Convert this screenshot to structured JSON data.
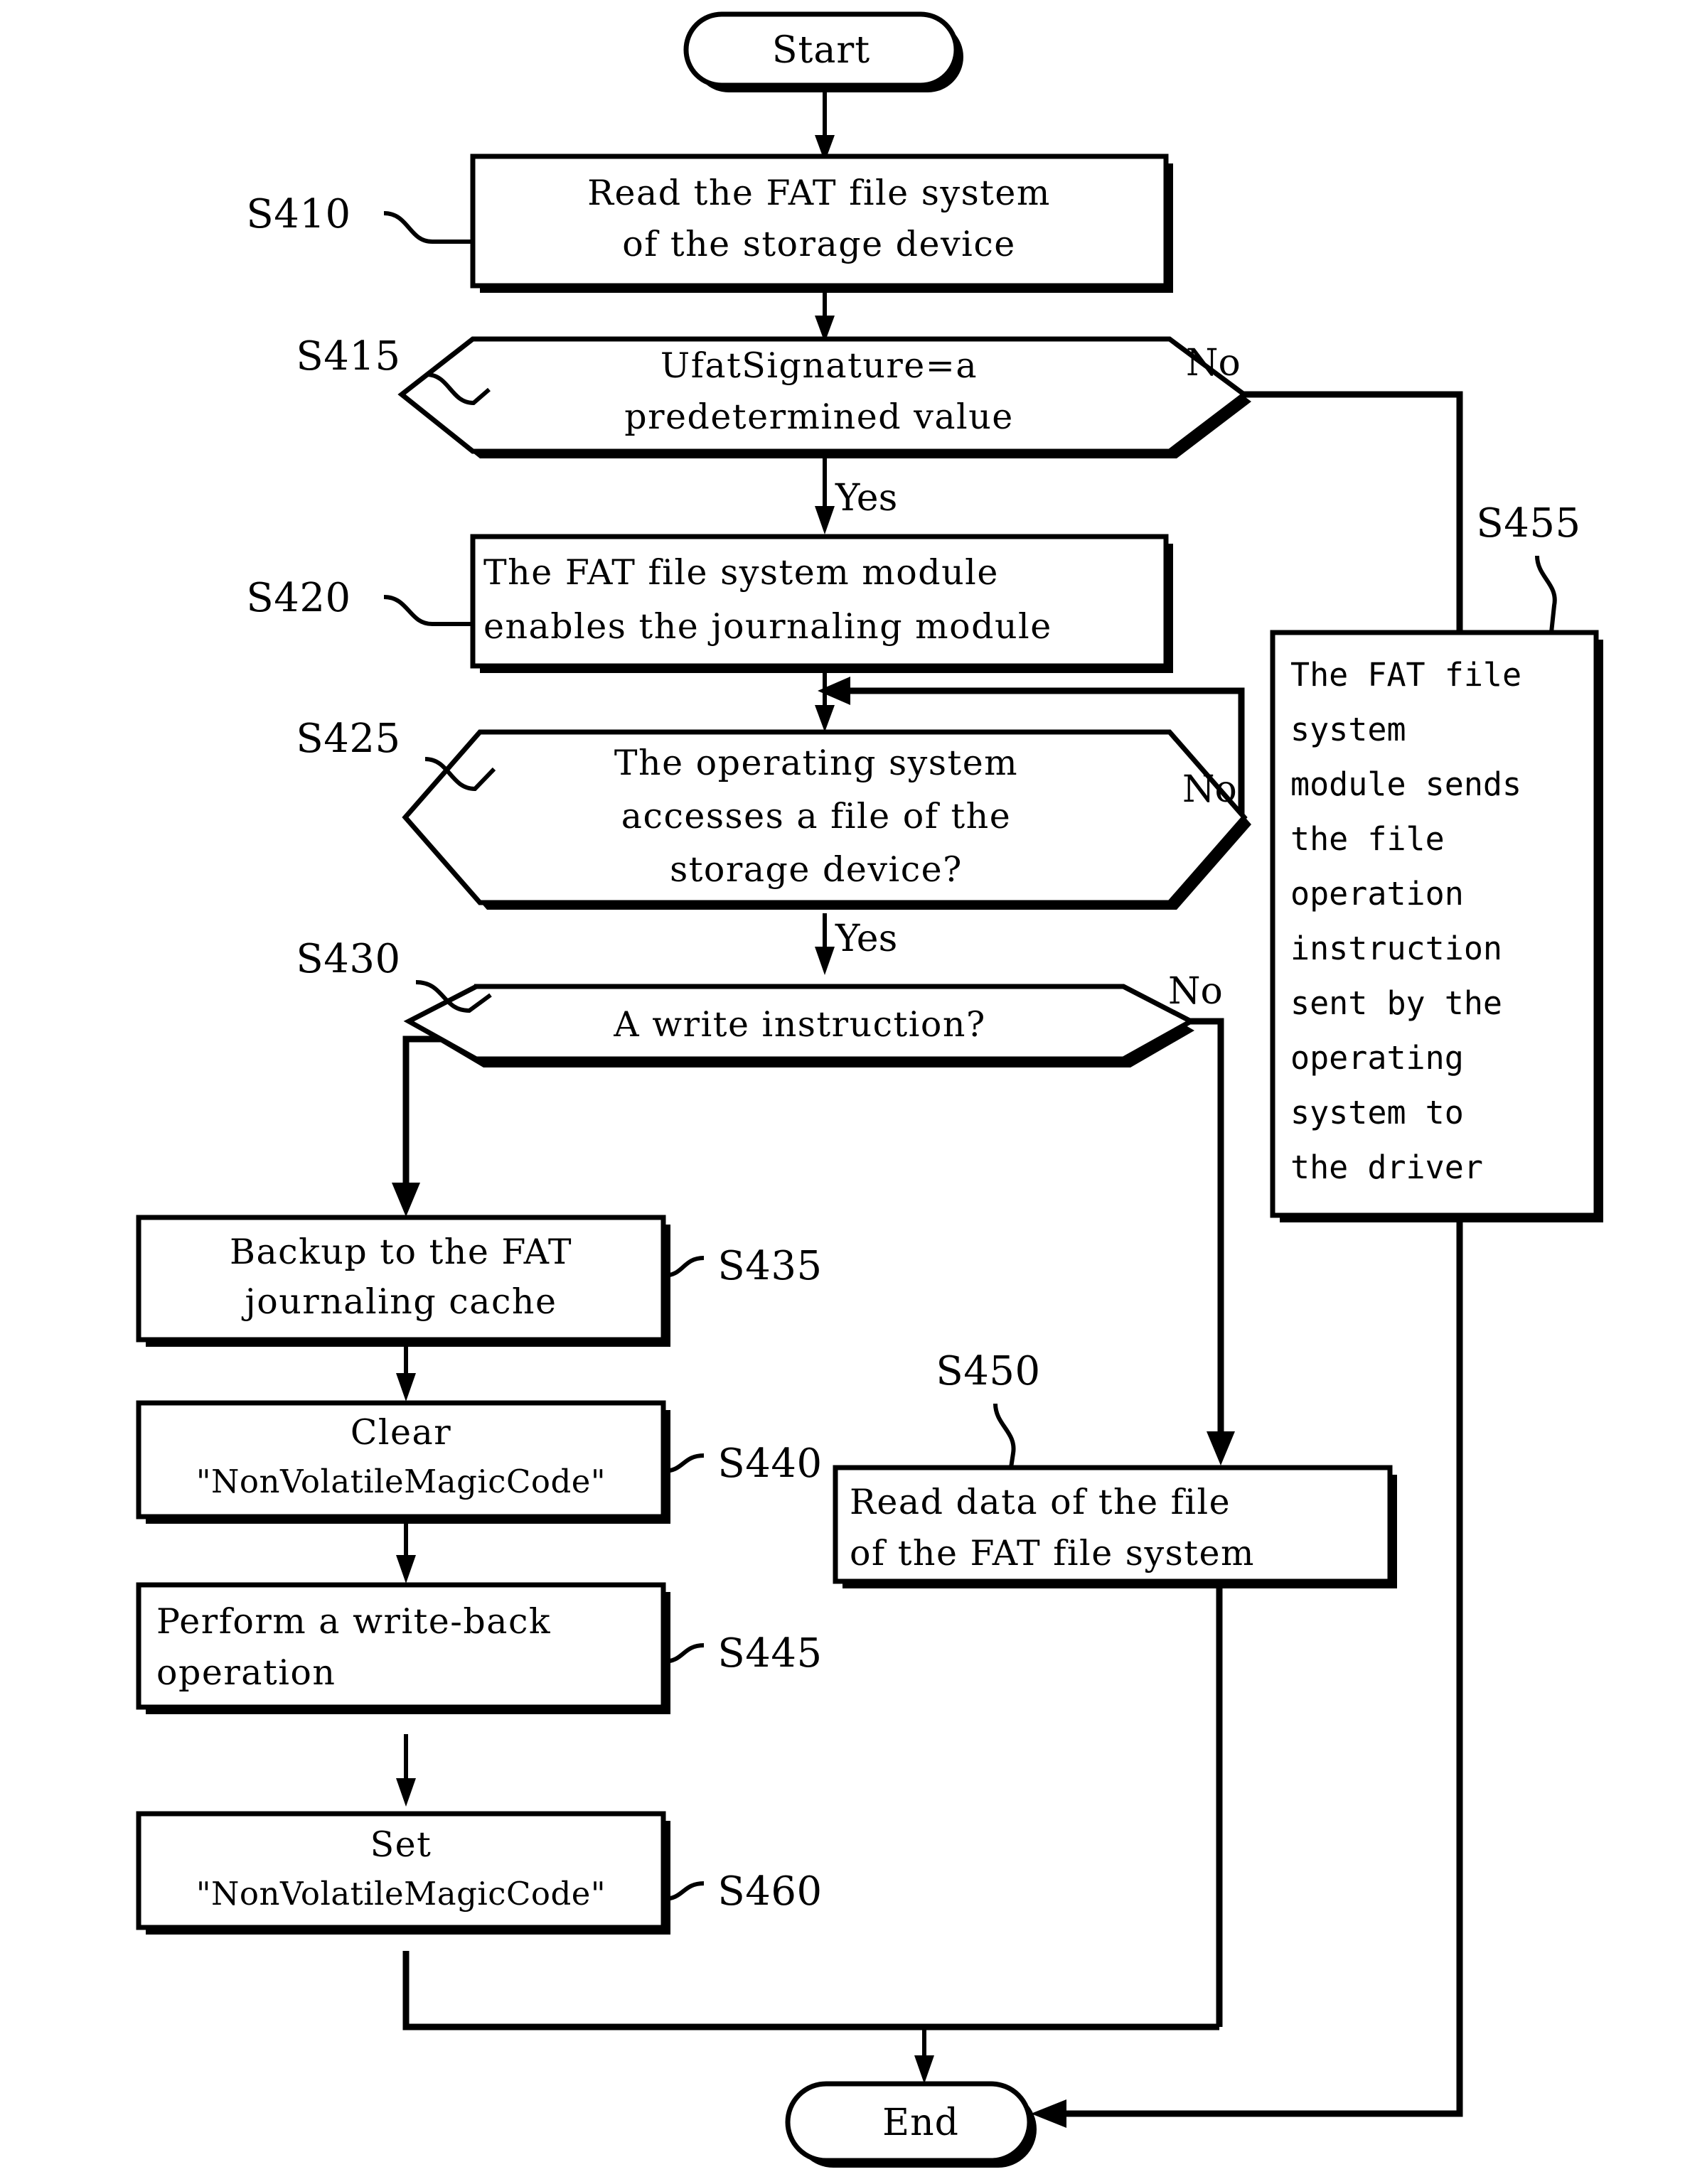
{
  "diagram": {
    "title_absent": true,
    "type": "flowchart",
    "nodes": {
      "start": {
        "id": "start",
        "shape": "terminator",
        "label": "Start"
      },
      "s410": {
        "id": "S410",
        "shape": "process",
        "step": "S410",
        "lines": [
          "Read the FAT file system",
          "of the storage device"
        ]
      },
      "s415": {
        "id": "S415",
        "shape": "decision",
        "step": "S415",
        "lines": [
          "UfatSignature=a",
          "predetermined value"
        ]
      },
      "s420": {
        "id": "S420",
        "shape": "process",
        "step": "S420",
        "lines": [
          "The FAT file system module",
          "enables the journaling module"
        ]
      },
      "s425": {
        "id": "S425",
        "shape": "decision",
        "step": "S425",
        "lines": [
          "The operating system",
          "accesses a file of the",
          "storage device?"
        ]
      },
      "s430": {
        "id": "S430",
        "shape": "decision",
        "step": "S430",
        "lines": [
          "A write instruction?"
        ]
      },
      "s435": {
        "id": "S435",
        "shape": "process",
        "step": "S435",
        "lines": [
          "Backup to the FAT",
          "journaling cache"
        ]
      },
      "s440": {
        "id": "S440",
        "shape": "process",
        "step": "S440",
        "lines": [
          "Clear",
          "\"NonVolatileMagicCode\""
        ]
      },
      "s445": {
        "id": "S445",
        "shape": "process",
        "step": "S445",
        "lines": [
          "Perform a write-back",
          "operation"
        ]
      },
      "s460": {
        "id": "S460",
        "shape": "process",
        "step": "S460",
        "lines": [
          "Set",
          "\"NonVolatileMagicCode\""
        ]
      },
      "s450": {
        "id": "S450",
        "shape": "process",
        "step": "S450",
        "lines": [
          "Read data of the file",
          "of the FAT file system"
        ]
      },
      "s455": {
        "id": "S455",
        "shape": "process",
        "step": "S455",
        "lines": [
          "The FAT file",
          "system",
          "module sends",
          "the file",
          "operation",
          "instruction",
          "sent by the",
          "operating",
          "system to",
          "the driver"
        ]
      },
      "end": {
        "id": "end",
        "shape": "terminator",
        "label": "End"
      }
    },
    "branch_labels": {
      "s415_no": "No",
      "s415_yes": "Yes",
      "s425_no": "No",
      "s425_yes": "Yes",
      "s430_no": "No"
    },
    "step_labels": {
      "s410": "S410",
      "s415": "S415",
      "s420": "S420",
      "s425": "S425",
      "s430": "S430",
      "s435": "S435",
      "s440": "S440",
      "s445": "S445",
      "s450": "S450",
      "s455": "S455",
      "s460": "S460"
    },
    "colors": {
      "stroke": "#000000",
      "fill": "#ffffff",
      "text": "#000000"
    }
  }
}
